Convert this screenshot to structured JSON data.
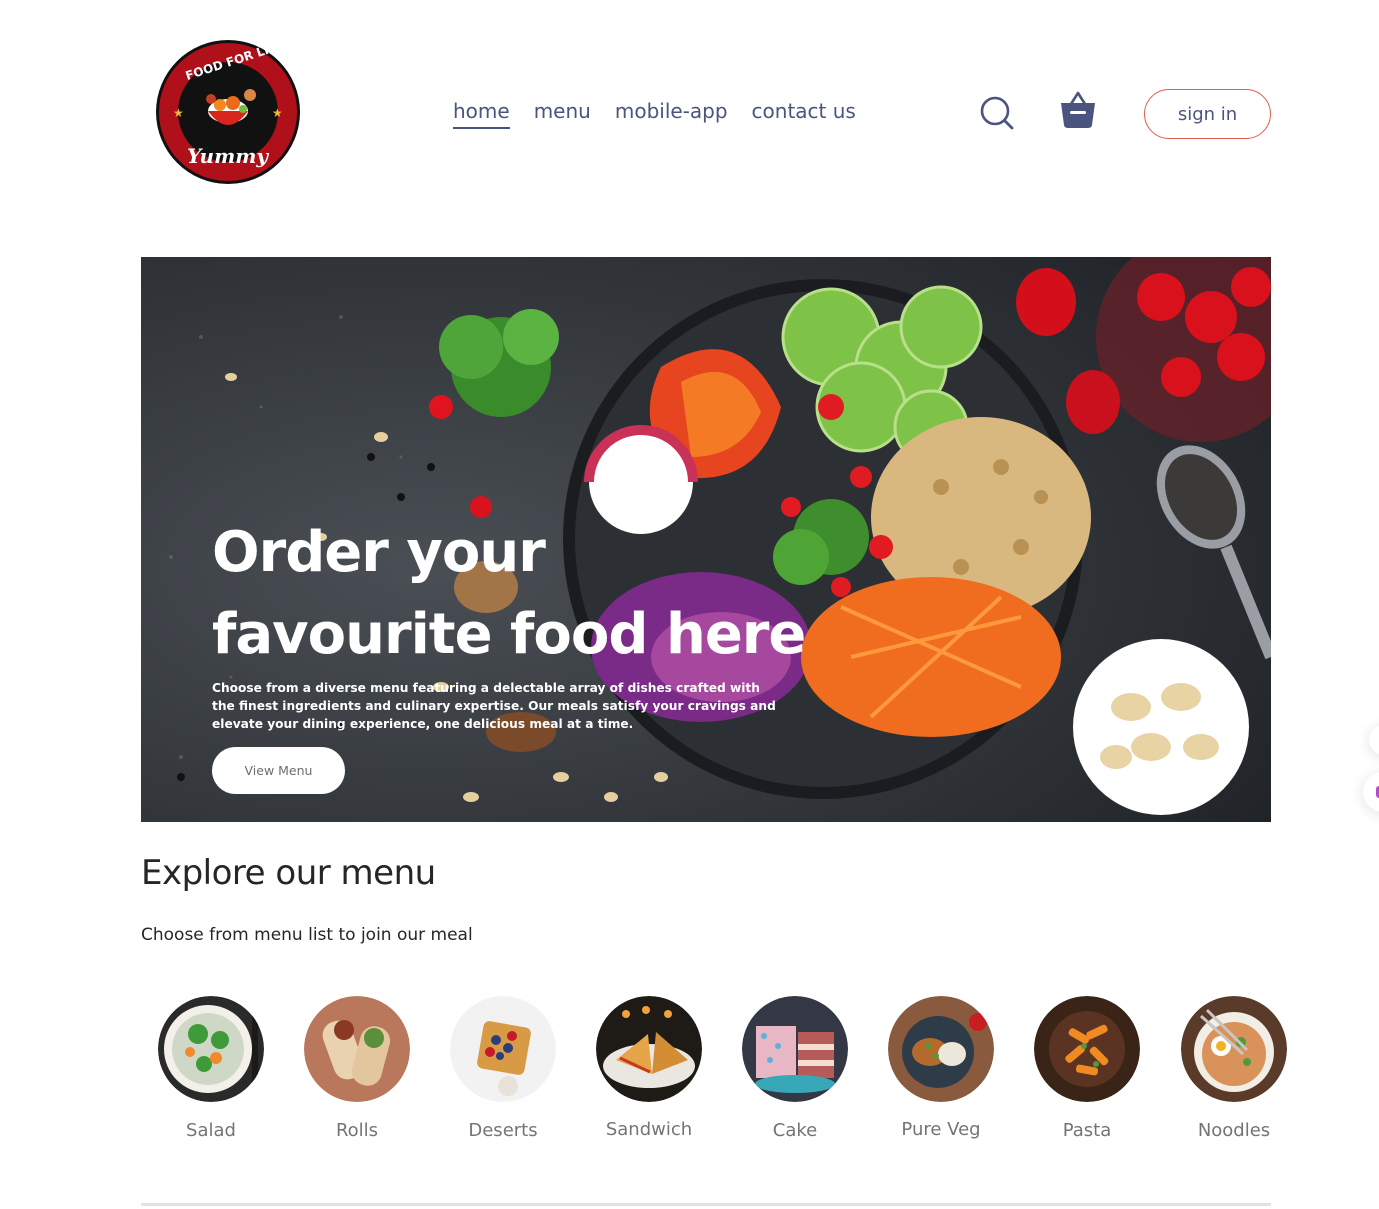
{
  "brand": {
    "logo_top_text": "FOOD FOR LIFE",
    "logo_script_text": "Yummy"
  },
  "nav": {
    "items": [
      {
        "label": "home",
        "active": true
      },
      {
        "label": "menu",
        "active": false
      },
      {
        "label": "mobile-app",
        "active": false
      },
      {
        "label": "contact us",
        "active": false
      }
    ]
  },
  "header": {
    "search_icon": "search-icon",
    "basket_icon": "basket-icon",
    "sign_in_label": "sign in"
  },
  "hero": {
    "title": "Order your favourite food here",
    "description": "Choose from a diverse menu featuring a delectable array of dishes crafted with the finest ingredients and culinary expertise. Our meals satisfy your cravings and elevate your dining experience, one delicious meal at a time.",
    "button_label": "View Menu"
  },
  "explore": {
    "title": "Explore our menu",
    "subtitle": "Choose from menu list to join our meal",
    "items": [
      {
        "label": "Salad"
      },
      {
        "label": "Rolls"
      },
      {
        "label": "Deserts"
      },
      {
        "label": "Sandwich"
      },
      {
        "label": "Cake"
      },
      {
        "label": "Pure Veg"
      },
      {
        "label": "Pasta"
      },
      {
        "label": "Noodles"
      }
    ]
  },
  "colors": {
    "text": "#49557e",
    "accent": "#e35d4b",
    "heading": "#262626",
    "muted": "#747474"
  }
}
